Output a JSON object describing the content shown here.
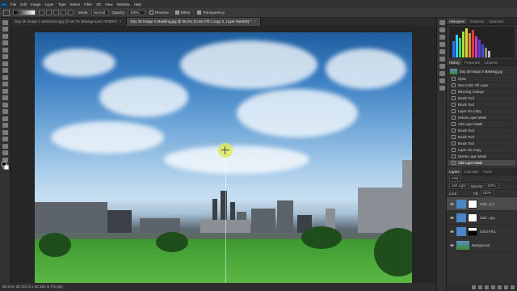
{
  "menu": [
    "File",
    "Edit",
    "Image",
    "Layer",
    "Type",
    "Select",
    "Filter",
    "3D",
    "View",
    "Window",
    "Help"
  ],
  "app_logo": "Ps",
  "options": {
    "mode_label": "Mode:",
    "mode_value": "Normal",
    "opacity_label": "Opacity:",
    "opacity_value": "100%",
    "reverse_label": "Reverse",
    "dither_label": "Dither",
    "transparency_label": "Transparency"
  },
  "tabs": [
    {
      "label": "Day 30 Image 1 Selections.jpg @ 66.7% (Background, RGB/8*)",
      "close": "×"
    },
    {
      "label": "Day 30 Image 2 Masking.jpg @ 56.2% (Color Fill 1 copy 2, Layer Mask/8) *",
      "close": "×"
    }
  ],
  "status": "56.21%   26.722 in x 20.153 in (72 ppi)",
  "histogram_tabs": [
    "Histogram",
    "Gradients",
    "Swatches"
  ],
  "history_tabs": [
    "History",
    "Properties",
    "Libraries"
  ],
  "history_snapshot": "Day 30 Image 2 Masking.jpg",
  "history_items": [
    "Open",
    "New Color Fill Layer",
    "Blending Change",
    "Brush Tool",
    "Brush Tool",
    "Layer Via Copy",
    "Delete Layer Mask",
    "Add Layer Mask",
    "Brush Tool",
    "Brush Tool",
    "Brush Tool",
    "Layer Via Copy",
    "Delete Layer Mask",
    "Add Layer Mask"
  ],
  "layers_tabs": [
    "Layers",
    "Channels",
    "Paths"
  ],
  "layers_kind": "Kind",
  "layers_blend": "Soft Light",
  "layers_opacity_label": "Opacity:",
  "layers_opacity_value": "100%",
  "layers_lock_label": "Lock:",
  "layers_fill_label": "Fill:",
  "layers_fill_value": "100%",
  "layers": [
    "Colo...y 2",
    "Colo...opy",
    "Color Fill 1",
    "Background"
  ],
  "colors": {
    "accent": "#31a8ff",
    "panel": "#323232"
  }
}
